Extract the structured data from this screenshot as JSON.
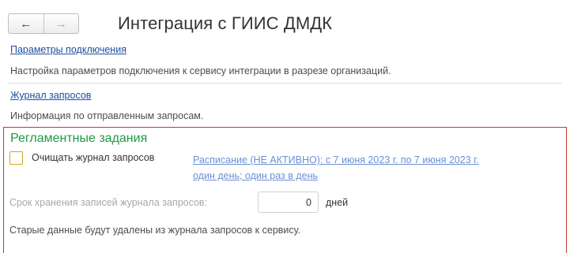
{
  "nav": {
    "back_glyph": "←",
    "forward_glyph": "→"
  },
  "page": {
    "title": "Интеграция с ГИИС ДМДК"
  },
  "sections": [
    {
      "link": "Параметры подключения",
      "description": "Настройка параметров подключения к сервису интеграции в разрезе организаций."
    },
    {
      "link": "Журнал запросов",
      "description": "Информация по отправленным запросам."
    }
  ],
  "scheduled_tasks": {
    "title": "Регламентные задания",
    "clear_log_checkbox": {
      "label": "Очищать журнал запросов",
      "checked": false
    },
    "schedule_link": {
      "line1": "Расписание (НЕ АКТИВНО): с 7 июня 2023 г. по 7 июня 2023 г.",
      "line2": "один день; один раз в день"
    },
    "retention": {
      "label": "Срок хранения записей журнала запросов:",
      "value": "0",
      "unit": "дней"
    },
    "info": "Старые данные будут удалены из журнала запросов к сервису."
  },
  "colors": {
    "link": "#1d4fa0",
    "group_title": "#1e9a46",
    "group_border": "#c0392b",
    "checkbox_border": "#d6a21f"
  }
}
